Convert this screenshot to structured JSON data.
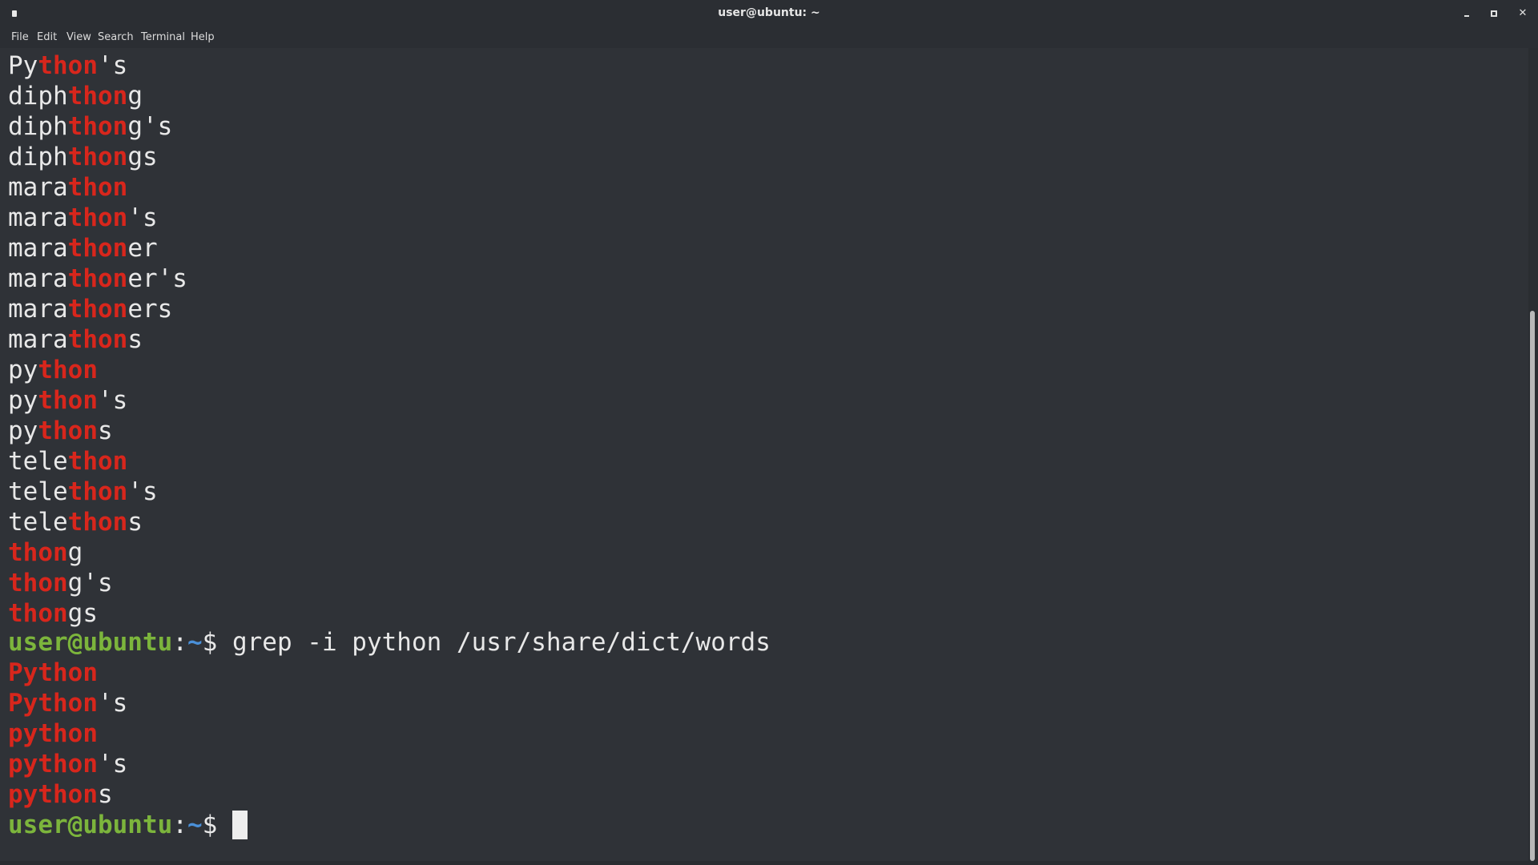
{
  "window": {
    "title": "user@ubuntu: ~",
    "minimize_icon": "minimize-icon",
    "maximize_icon": "maximize-icon",
    "close_icon": "close-icon",
    "close_glyph": "✕"
  },
  "menu": {
    "items": [
      "File",
      "Edit",
      "View",
      "Search",
      "Terminal",
      "Help"
    ]
  },
  "colors": {
    "background": "#2f3237",
    "text": "#e8e8e8",
    "match": "#d8261c",
    "prompt_user": "#7cb53c",
    "prompt_path": "#4a90d9"
  },
  "prompt": {
    "user": "user@ubuntu",
    "colon": ":",
    "path": "~",
    "symbol": "$ "
  },
  "command": "grep -i python /usr/share/dict/words",
  "previous_output": [
    {
      "pre": "Py",
      "match": "thon",
      "post": "'s"
    },
    {
      "pre": "diph",
      "match": "thon",
      "post": "g"
    },
    {
      "pre": "diph",
      "match": "thon",
      "post": "g's"
    },
    {
      "pre": "diph",
      "match": "thon",
      "post": "gs"
    },
    {
      "pre": "mara",
      "match": "thon",
      "post": ""
    },
    {
      "pre": "mara",
      "match": "thon",
      "post": "'s"
    },
    {
      "pre": "mara",
      "match": "thon",
      "post": "er"
    },
    {
      "pre": "mara",
      "match": "thon",
      "post": "er's"
    },
    {
      "pre": "mara",
      "match": "thon",
      "post": "ers"
    },
    {
      "pre": "mara",
      "match": "thon",
      "post": "s"
    },
    {
      "pre": "py",
      "match": "thon",
      "post": ""
    },
    {
      "pre": "py",
      "match": "thon",
      "post": "'s"
    },
    {
      "pre": "py",
      "match": "thon",
      "post": "s"
    },
    {
      "pre": "tele",
      "match": "thon",
      "post": ""
    },
    {
      "pre": "tele",
      "match": "thon",
      "post": "'s"
    },
    {
      "pre": "tele",
      "match": "thon",
      "post": "s"
    },
    {
      "pre": "",
      "match": "thon",
      "post": "g"
    },
    {
      "pre": "",
      "match": "thon",
      "post": "g's"
    },
    {
      "pre": "",
      "match": "thon",
      "post": "gs"
    }
  ],
  "grep_output": [
    {
      "pre": "",
      "match": "Python",
      "post": ""
    },
    {
      "pre": "",
      "match": "Python",
      "post": "'s"
    },
    {
      "pre": "",
      "match": "python",
      "post": ""
    },
    {
      "pre": "",
      "match": "python",
      "post": "'s"
    },
    {
      "pre": "",
      "match": "python",
      "post": "s"
    }
  ]
}
